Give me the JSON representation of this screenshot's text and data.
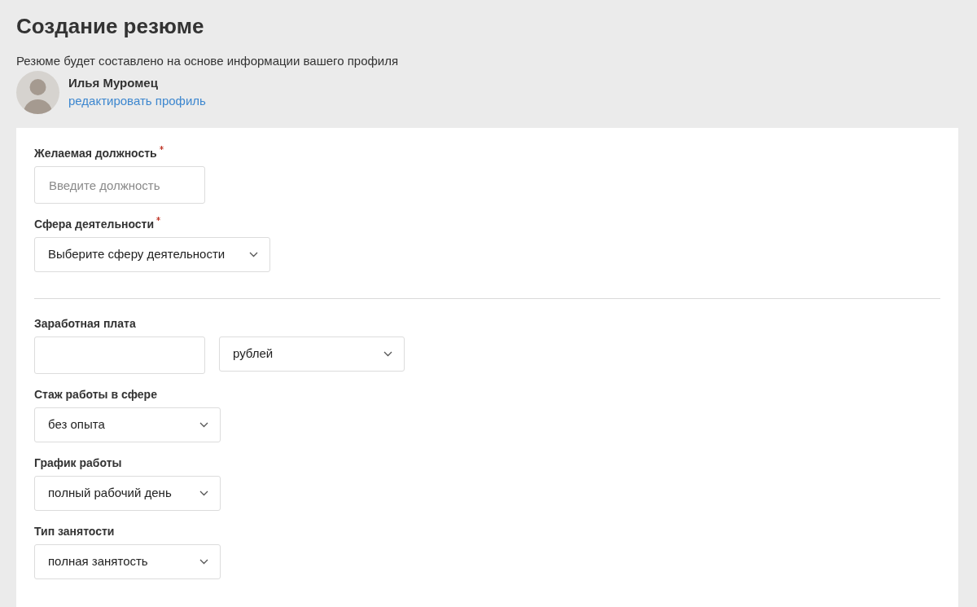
{
  "page": {
    "title": "Создание резюме",
    "subtitle": "Резюме будет составлено на основе информации вашего профиля"
  },
  "profile": {
    "name": "Илья Муромец",
    "edit_link": "редактировать профиль"
  },
  "sections": [
    {
      "fields": [
        {
          "label": "Желаемая должность",
          "required": true,
          "controls": [
            {
              "kind": "text",
              "placeholder": "Введите должность"
            }
          ]
        },
        {
          "label": "Сфера деятельности",
          "required": true,
          "controls": [
            {
              "kind": "select",
              "value": "Выберите сферу деятельности"
            }
          ]
        }
      ]
    },
    {
      "fields": [
        {
          "label": "Заработная плата",
          "required": false,
          "controls": [
            {
              "kind": "text"
            },
            {
              "kind": "select",
              "value": "рублей"
            }
          ]
        },
        {
          "label": "Стаж работы в сфере",
          "required": false,
          "controls": [
            {
              "kind": "select",
              "value": "без опыта"
            }
          ]
        },
        {
          "label": "График работы",
          "required": false,
          "controls": [
            {
              "kind": "select",
              "value": "полный рабочий день"
            }
          ]
        },
        {
          "label": "Тип занятости",
          "required": false,
          "controls": [
            {
              "kind": "select",
              "value": "полная занятость"
            }
          ]
        }
      ]
    }
  ]
}
